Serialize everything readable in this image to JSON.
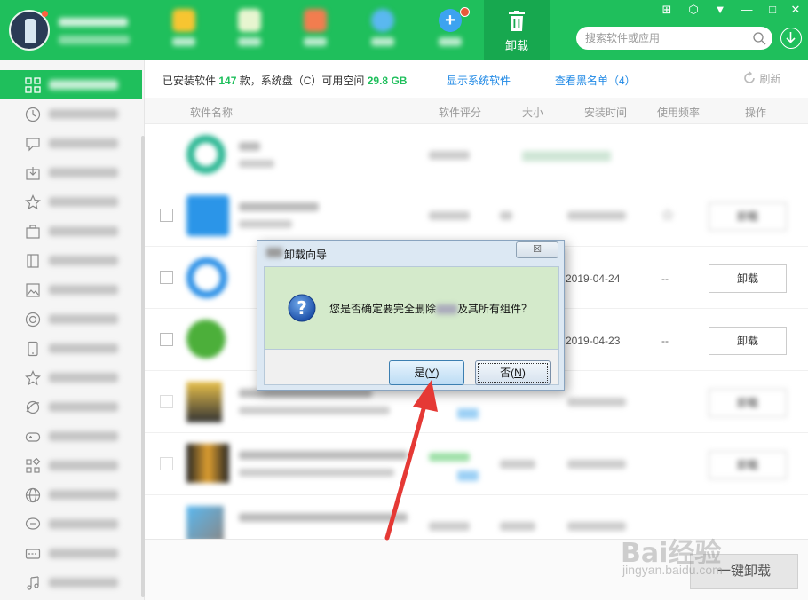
{
  "header": {
    "active_tab_label": "卸载",
    "search_placeholder": "搜索软件或应用",
    "window_controls": {
      "grid": "⊞",
      "skin": "⬡",
      "menu": "▼",
      "minimize": "—",
      "maximize": "□",
      "close": "✕"
    },
    "brand_color": "#1fbf5c"
  },
  "info_bar": {
    "prefix": "已安装软件",
    "count": "147",
    "middle": "款，系统盘（C）可用空间",
    "free_space": "29.8 GB",
    "show_system_link": "显示系统软件",
    "blacklist_link": "查看黑名单（4）",
    "refresh_label": "刷新"
  },
  "table": {
    "columns": {
      "name": "软件名称",
      "rating": "软件评分",
      "size": "大小",
      "install_time": "安装时间",
      "frequency": "使用频率",
      "action": "操作"
    },
    "rows": [
      {
        "date": "",
        "freq": "",
        "button": ""
      },
      {
        "date": "",
        "freq": "",
        "button": "卸载"
      },
      {
        "date": "2019-04-24",
        "freq": "--",
        "button": "卸载"
      },
      {
        "date": "2019-04-23",
        "freq": "--",
        "button": "卸载"
      },
      {
        "date": "",
        "freq": "",
        "button": "卸载"
      },
      {
        "date": "",
        "freq": "",
        "button": "卸载"
      },
      {
        "date": "",
        "freq": "",
        "button": ""
      }
    ],
    "app_icons": [
      "circle-app-icon",
      "folder-app-icon",
      "target-app-icon",
      "android-app-icon",
      "media-app-icon",
      "film-app-icon",
      "tools-app-icon"
    ]
  },
  "bottom_bar": {
    "one_click_uninstall": "一键卸载"
  },
  "dialog": {
    "title": "卸载向导",
    "close_label": "☒",
    "message_before": "您是否确定要完全删除",
    "message_after": "及其所有组件？",
    "yes_label": "是",
    "yes_key": "Y",
    "no_label": "否",
    "no_key": "N"
  },
  "watermark": {
    "logo": "Bai经验",
    "url": "jingyan.baidu.com"
  }
}
